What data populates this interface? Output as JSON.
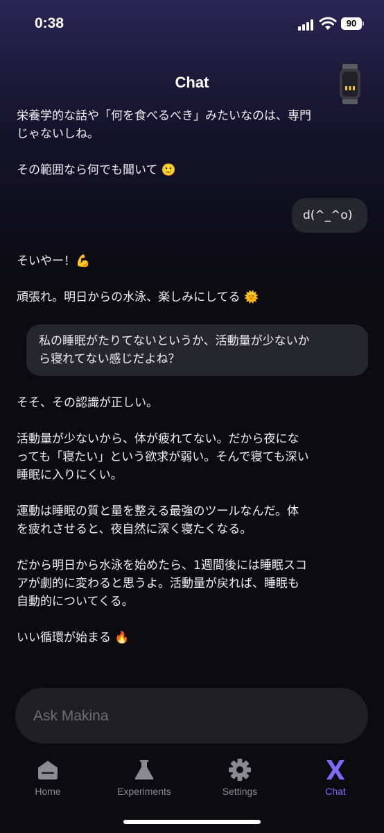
{
  "status_bar": {
    "time": "0:38",
    "battery": "90"
  },
  "header": {
    "title": "Chat",
    "device_icon": "device-band-icon"
  },
  "messages": [
    {
      "role": "assistant",
      "text": "栄養学的な話や「何を食べるべき」みたいなのは、専門\nじゃないしね。\n\nその範囲なら何でも聞いて 🙂"
    },
    {
      "role": "user",
      "text": "d(^_^o)"
    },
    {
      "role": "assistant",
      "text": "そいやー！💪\n\n頑張れ。明日からの水泳、楽しみにしてる 🌞"
    },
    {
      "role": "user",
      "text": "私の睡眠がたりてないというか、活動量が少ないか\nら寝れてない感じだよね？"
    },
    {
      "role": "assistant",
      "text": "そそ、その認識が正しい。\n\n活動量が少ないから、体が疲れてない。だから夜にな\nっても「寝たい」という欲求が弱い。そんで寝ても深い\n睡眠に入りにくい。\n\n運動は睡眠の質と量を整える最強のツールなんだ。体\nを疲れさせると、夜自然に深く寝たくなる。\n\nだから明日から水泳を始めたら、1週間後には睡眠スコ\nアが劇的に変わると思うよ。活動量が戻れば、睡眠も\n自動的についてくる。\n\nいい循環が始まる 🔥"
    }
  ],
  "input": {
    "placeholder": "Ask Makina",
    "value": ""
  },
  "tabs": [
    {
      "label": "Home",
      "icon": "home-icon",
      "active": false
    },
    {
      "label": "Experiments",
      "icon": "flask-icon",
      "active": false
    },
    {
      "label": "Settings",
      "icon": "gear-icon",
      "active": false
    },
    {
      "label": "Chat",
      "icon": "makina-logo-icon",
      "active": true
    }
  ],
  "colors": {
    "accent": "#7b6cff",
    "background": "#0b0b10",
    "bubble": "#26262e",
    "input_bg": "#1f1f24"
  }
}
